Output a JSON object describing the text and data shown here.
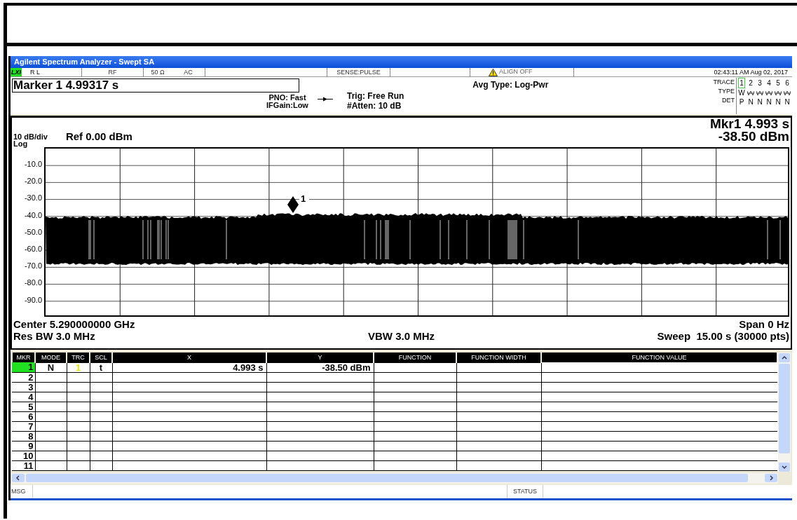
{
  "window": {
    "title": "Agilent Spectrum Analyzer - Swept SA"
  },
  "status_bar": {
    "badge": "LXI",
    "cells": [
      "R L",
      "RF",
      "50 Ω",
      "AC",
      "SENSE:PULSE"
    ],
    "alert": "ALIGN OFF",
    "datetime": "02:43:11 AM Aug 02, 2017"
  },
  "marker_field": {
    "value": "Marker 1 4.99317 s"
  },
  "settings": {
    "pno": "PNO: Fast",
    "ifgain": "IFGain:Low",
    "trig": "Trig: Free Run",
    "atten": "#Atten: 10 dB",
    "avg_type": "Avg Type: Log-Pwr"
  },
  "trace_panel": {
    "labels": [
      "TRACE",
      "TYPE",
      "DET"
    ],
    "traces": [
      {
        "label": "1",
        "selected": true,
        "kind": "write",
        "type": "W",
        "det": "P"
      },
      {
        "label": "2",
        "selected": false,
        "kind": "blank",
        "det": "N"
      },
      {
        "label": "3",
        "selected": false,
        "kind": "blank",
        "det": "N"
      },
      {
        "label": "4",
        "selected": false,
        "kind": "blank",
        "det": "N"
      },
      {
        "label": "5",
        "selected": false,
        "kind": "blank",
        "det": "N"
      },
      {
        "label": "6",
        "selected": false,
        "kind": "blank",
        "det": "N"
      }
    ]
  },
  "graph": {
    "scale": "10 dB/div",
    "scale_type": "Log",
    "ref": "Ref 0.00 dBm",
    "marker_readout": [
      "Mkr1 4.993 s",
      "-38.50 dBm"
    ],
    "y_labels": [
      "-10.0",
      "-20.0",
      "-30.0",
      "-40.0",
      "-50.0",
      "-60.0",
      "-70.0",
      "-80.0",
      "-90.0"
    ],
    "marker_label": "1",
    "center": "Center 5.290000000 GHz",
    "span": "Span 0 Hz",
    "res_bw": "Res BW 3.0 MHz",
    "vbw": "VBW 3.0 MHz",
    "sweep": "Sweep  15.00 s (30000 pts)"
  },
  "marker_table": {
    "columns": [
      "MKR",
      "MODE",
      "TRC",
      "SCL",
      "X",
      "Y",
      "FUNCTION",
      "FUNCTION WIDTH",
      "FUNCTION VALUE"
    ],
    "rows": [
      {
        "mkr": "1",
        "selected": true,
        "mode": "N",
        "trc": "1",
        "scl": "t",
        "x": "4.993 s",
        "y": "-38.50 dBm"
      },
      {
        "mkr": "2",
        "selected": false
      },
      {
        "mkr": "3",
        "selected": false
      },
      {
        "mkr": "4",
        "selected": false
      },
      {
        "mkr": "5",
        "selected": false
      },
      {
        "mkr": "6",
        "selected": false
      },
      {
        "mkr": "7",
        "selected": false
      },
      {
        "mkr": "8",
        "selected": false
      },
      {
        "mkr": "9",
        "selected": false
      },
      {
        "mkr": "10",
        "selected": false
      },
      {
        "mkr": "11",
        "selected": false
      }
    ]
  },
  "footer": {
    "msg": "MSG",
    "status": "STATUS"
  }
}
